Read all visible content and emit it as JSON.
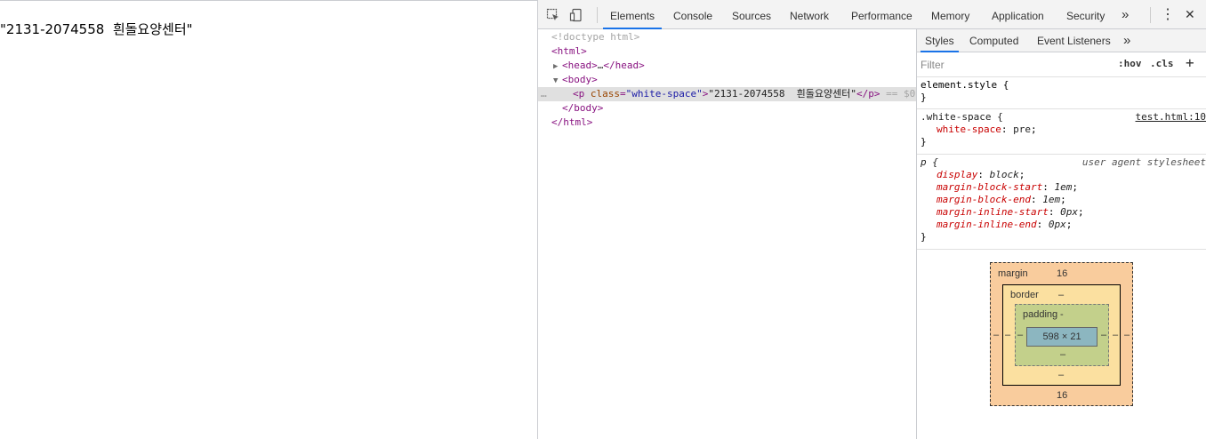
{
  "page": {
    "text": "\"2131-2074558  흰돌요양센터\""
  },
  "toolbar": {
    "tabs": [
      "Elements",
      "Console",
      "Sources",
      "Network",
      "Performance",
      "Memory",
      "Application",
      "Security"
    ],
    "more": "»",
    "menu": "⋮",
    "close": "✕"
  },
  "dom": {
    "doctype": "<!doctype html>",
    "html_open": "<html>",
    "head_open": "<head>",
    "ellipsis": "…",
    "head_close": "</head>",
    "body_open": "<body>",
    "dots": "…",
    "p_open": "<p",
    "p_attr_name": "class",
    "p_attr_value": "\"white-space\"",
    "p_text": "\"2131-2074558  흰돌요양센터\"",
    "p_close": "</p>",
    "eq": " == $0",
    "body_close": "</body>",
    "html_close": "</html>"
  },
  "styles": {
    "tabs": [
      "Styles",
      "Computed",
      "Event Listeners"
    ],
    "more": "»",
    "filter_placeholder": "Filter",
    "hov": ":hov",
    "cls": ".cls",
    "add": "+",
    "element_style": "element.style {",
    "close_brace": "}",
    "rule1": {
      "selector": ".white-space {",
      "source": "test.html:10",
      "decl": [
        {
          "prop": "white-space",
          "val": "pre"
        }
      ]
    },
    "rule2": {
      "selector": "p {",
      "source": "user agent stylesheet",
      "decl": [
        {
          "prop": "display",
          "val": "block"
        },
        {
          "prop": "margin-block-start",
          "val": "1em"
        },
        {
          "prop": "margin-block-end",
          "val": "1em"
        },
        {
          "prop": "margin-inline-start",
          "val": "0px"
        },
        {
          "prop": "margin-inline-end",
          "val": "0px"
        }
      ]
    }
  },
  "box_model": {
    "margin_label": "margin",
    "margin_top": "16",
    "margin_bottom": "16",
    "margin_left": "–",
    "margin_right": "–",
    "border_label": "border",
    "border_top": "–",
    "border_bottom": "–",
    "border_left": "–",
    "border_right": "–",
    "padding_label": "padding",
    "padding_top": "-",
    "padding_bottom": "–",
    "padding_left": "–",
    "padding_right": "–",
    "content": "598 × 21",
    "colors": {
      "margin": "#f9cc9d",
      "border": "#fbe0a0",
      "padding": "#c3d08b",
      "content": "#8cb6c0"
    }
  }
}
